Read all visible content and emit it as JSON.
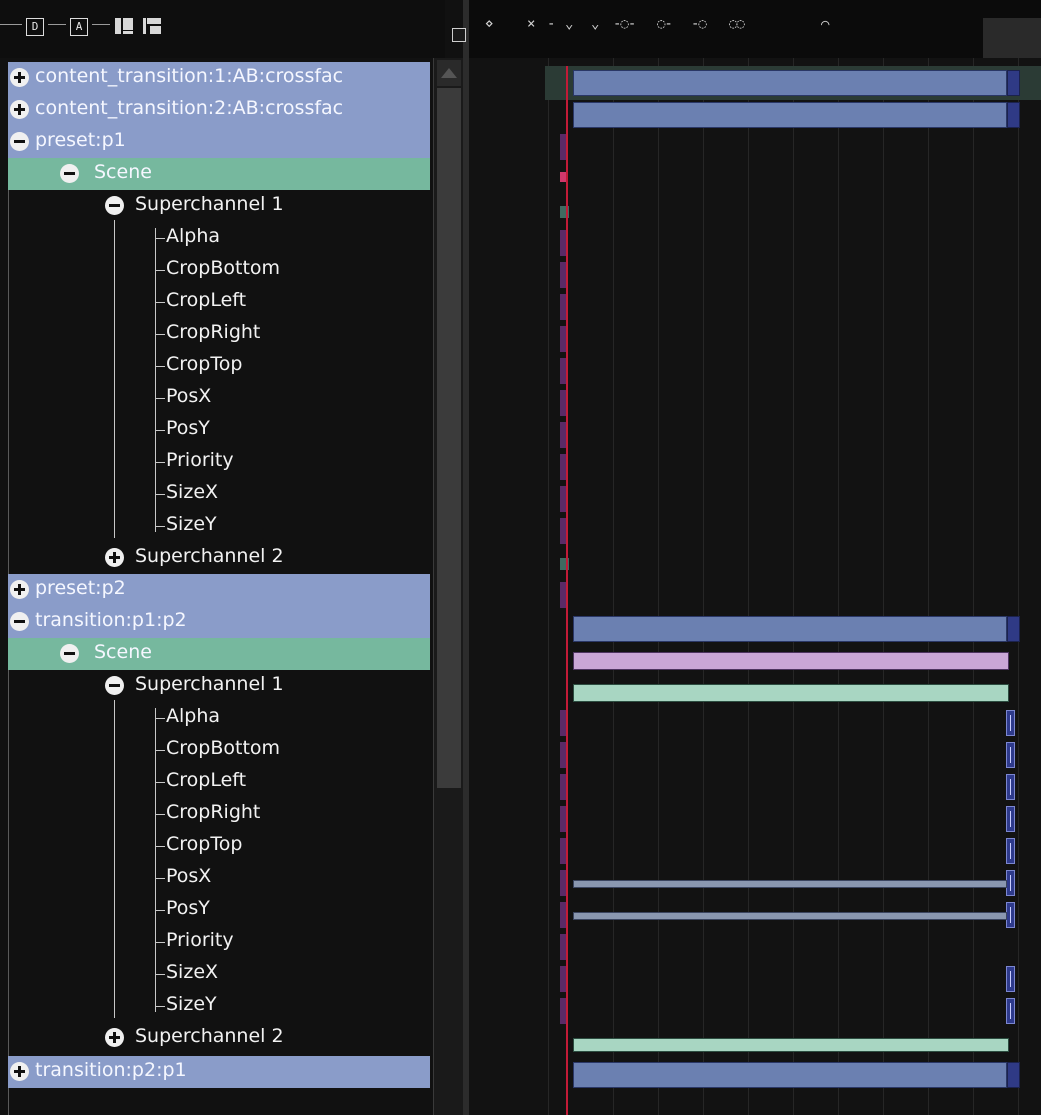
{
  "toolbar_left": {
    "buttons": [
      {
        "name": "add-d-icon",
        "text": "D"
      },
      {
        "name": "add-a-icon",
        "text": "A"
      },
      {
        "name": "film-icon",
        "text": ""
      },
      {
        "name": "save-icon",
        "text": ""
      }
    ]
  },
  "toolbar_right": {
    "icons": [
      "keyframe-diamond-icon",
      "keyframe-x-icon",
      "keyframe-down-icon",
      "keyframe-down-2-icon",
      "clip-left-icon",
      "clip-right-icon",
      "clip-cross-icon",
      "clip-double-icon",
      "curve-icon"
    ]
  },
  "tree": {
    "rows": [
      {
        "label": "content_transition:1:AB:crossfac",
        "toggle": "plus",
        "style": "blue"
      },
      {
        "label": "content_transition:2:AB:crossfac",
        "toggle": "plus",
        "style": "blue"
      },
      {
        "label": "preset:p1",
        "toggle": "minus",
        "style": "blue"
      },
      {
        "label": "Scene",
        "toggle": "minus",
        "style": "green"
      },
      {
        "label": "Superchannel 1",
        "toggle": "minus",
        "style": "none"
      },
      {
        "label": "Alpha"
      },
      {
        "label": "CropBottom"
      },
      {
        "label": "CropLeft"
      },
      {
        "label": "CropRight"
      },
      {
        "label": "CropTop"
      },
      {
        "label": "PosX"
      },
      {
        "label": "PosY"
      },
      {
        "label": "Priority"
      },
      {
        "label": "SizeX"
      },
      {
        "label": "SizeY"
      },
      {
        "label": "Superchannel 2",
        "toggle": "plus",
        "style": "none"
      },
      {
        "label": "preset:p2",
        "toggle": "plus",
        "style": "blue"
      },
      {
        "label": "transition:p1:p2",
        "toggle": "minus",
        "style": "blue"
      },
      {
        "label": "Scene",
        "toggle": "minus",
        "style": "green"
      },
      {
        "label": "Superchannel 1",
        "toggle": "minus",
        "style": "none"
      },
      {
        "label": "Alpha"
      },
      {
        "label": "CropBottom"
      },
      {
        "label": "CropLeft"
      },
      {
        "label": "CropRight"
      },
      {
        "label": "CropTop"
      },
      {
        "label": "PosX"
      },
      {
        "label": "PosY"
      },
      {
        "label": "Priority"
      },
      {
        "label": "SizeX"
      },
      {
        "label": "SizeY"
      },
      {
        "label": "Superchannel 2",
        "toggle": "plus",
        "style": "none"
      },
      {
        "label": "transition:p2:p1",
        "toggle": "plus",
        "style": "blue"
      }
    ]
  },
  "colors": {
    "track_blue": "#8a9cc9",
    "track_green": "#76b89e",
    "playhead": "#c21b37",
    "clip_blue": "#6b80b1",
    "clip_purple": "#c9a6d6",
    "clip_mint": "#a8d6c2"
  }
}
